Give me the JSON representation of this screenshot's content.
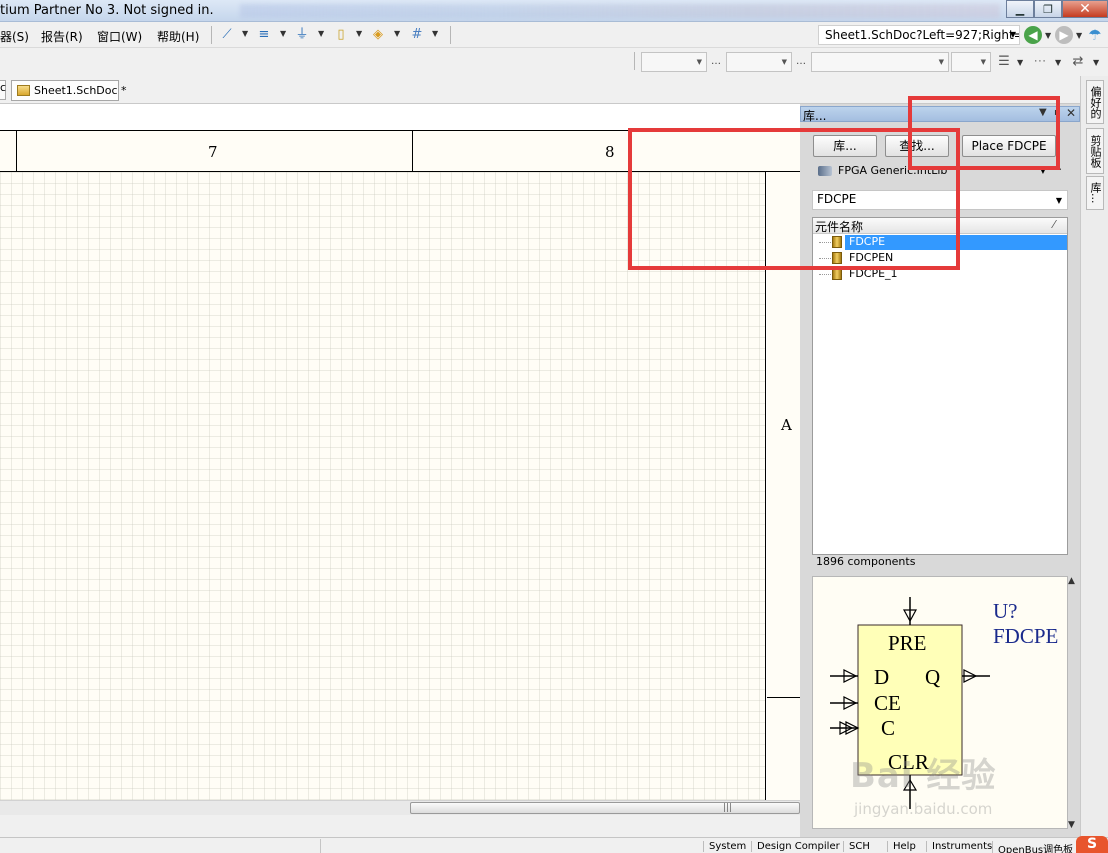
{
  "window": {
    "title": "tium Partner No 3. Not signed in."
  },
  "menu": {
    "items": [
      "器(S)",
      "报告(R)",
      "窗口(W)",
      "帮助(H)"
    ]
  },
  "toolbar": {
    "address": "Sheet1.SchDoc?Left=927;Right="
  },
  "tabs": {
    "left_stub": "c",
    "active": "Sheet1.SchDoc *"
  },
  "sheet": {
    "column_7": "7",
    "column_8": "8",
    "zone_a": "A"
  },
  "library_panel": {
    "title": "库...",
    "btn_libraries": "库...",
    "btn_search": "查找...",
    "btn_place": "Place FDCPE",
    "library_name": "FPGA Generic.IntLib",
    "filter_value": "FDCPE",
    "column_header": "元件名称",
    "components": [
      "FDCPE",
      "FDCPEN",
      "FDCPE_1"
    ],
    "selected_index": 0,
    "count_text": "1896 components",
    "preview": {
      "designator": "U?",
      "comment": "FDCPE",
      "pin_top": "PRE",
      "pin_d": "D",
      "pin_q": "Q",
      "pin_ce": "CE",
      "pin_c": "C",
      "pin_bottom": "CLR"
    }
  },
  "dock_tabs": [
    "偏好的",
    "剪贴板",
    "库..."
  ],
  "statusbar": {
    "buttons": [
      "System",
      "Design Compiler",
      "SCH",
      "Help",
      "Instruments",
      "OpenBus调色板"
    ]
  },
  "watermark": {
    "main": "Bai 经验",
    "sub": "jingyan.baidu.com"
  },
  "colors": {
    "selection": "#3399ff",
    "annotation": "#e53a3a",
    "sheet_bg": "#fffdf6"
  }
}
